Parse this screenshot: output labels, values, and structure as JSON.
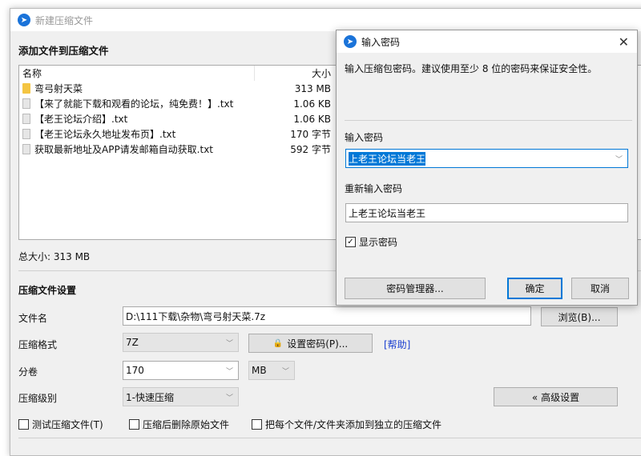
{
  "main": {
    "title": "新建压缩文件",
    "heading": "添加文件到压缩文件",
    "columns": {
      "name": "名称",
      "size": "大小"
    },
    "files": [
      {
        "name": "弯弓射天菜",
        "size": "313 MB",
        "type": "folder"
      },
      {
        "name": "【来了就能下载和观看的论坛，纯免费！】.txt",
        "size": "1.06 KB",
        "type": "file"
      },
      {
        "name": "【老王论坛介绍】.txt",
        "size": "1.06 KB",
        "type": "file"
      },
      {
        "name": "【老王论坛永久地址发布页】.txt",
        "size": "170 字节",
        "type": "file"
      },
      {
        "name": "获取最新地址及APP请发邮箱自动获取.txt",
        "size": "592 字节",
        "type": "file"
      }
    ],
    "total": "总大小: 313 MB",
    "settings_heading": "压缩文件设置",
    "filename_label": "文件名",
    "filename": "D:\\111下载\\杂物\\弯弓射天菜.7z",
    "browse": "浏览(B)...",
    "format_label": "压缩格式",
    "format": "7Z",
    "set_password": "设置密码(P)...",
    "help": "[帮助]",
    "split_label": "分卷",
    "split_value": "170",
    "split_unit": "MB",
    "level_label": "压缩级别",
    "level": "1-快速压缩",
    "advanced": "« 高级设置",
    "checkboxes": [
      {
        "label": "测试压缩文件(T)",
        "checked": false
      },
      {
        "label": "压缩后删除原始文件",
        "checked": false
      },
      {
        "label": "把每个文件/文件夹添加到独立的压缩文件",
        "checked": false
      }
    ]
  },
  "password_dialog": {
    "title": "输入密码",
    "hint": "输入压缩包密码。建议使用至少 8 位的密码来保证安全性。",
    "pw_label": "输入密码",
    "pw_value": "上老王论坛当老王",
    "re_label": "重新输入密码",
    "re_value": "上老王论坛当老王",
    "show": "显示密码",
    "show_checked": true,
    "manager": "密码管理器...",
    "ok": "确定",
    "cancel": "取消"
  },
  "colors": {
    "accent": "#0078d7",
    "link": "#1a3fd0"
  }
}
